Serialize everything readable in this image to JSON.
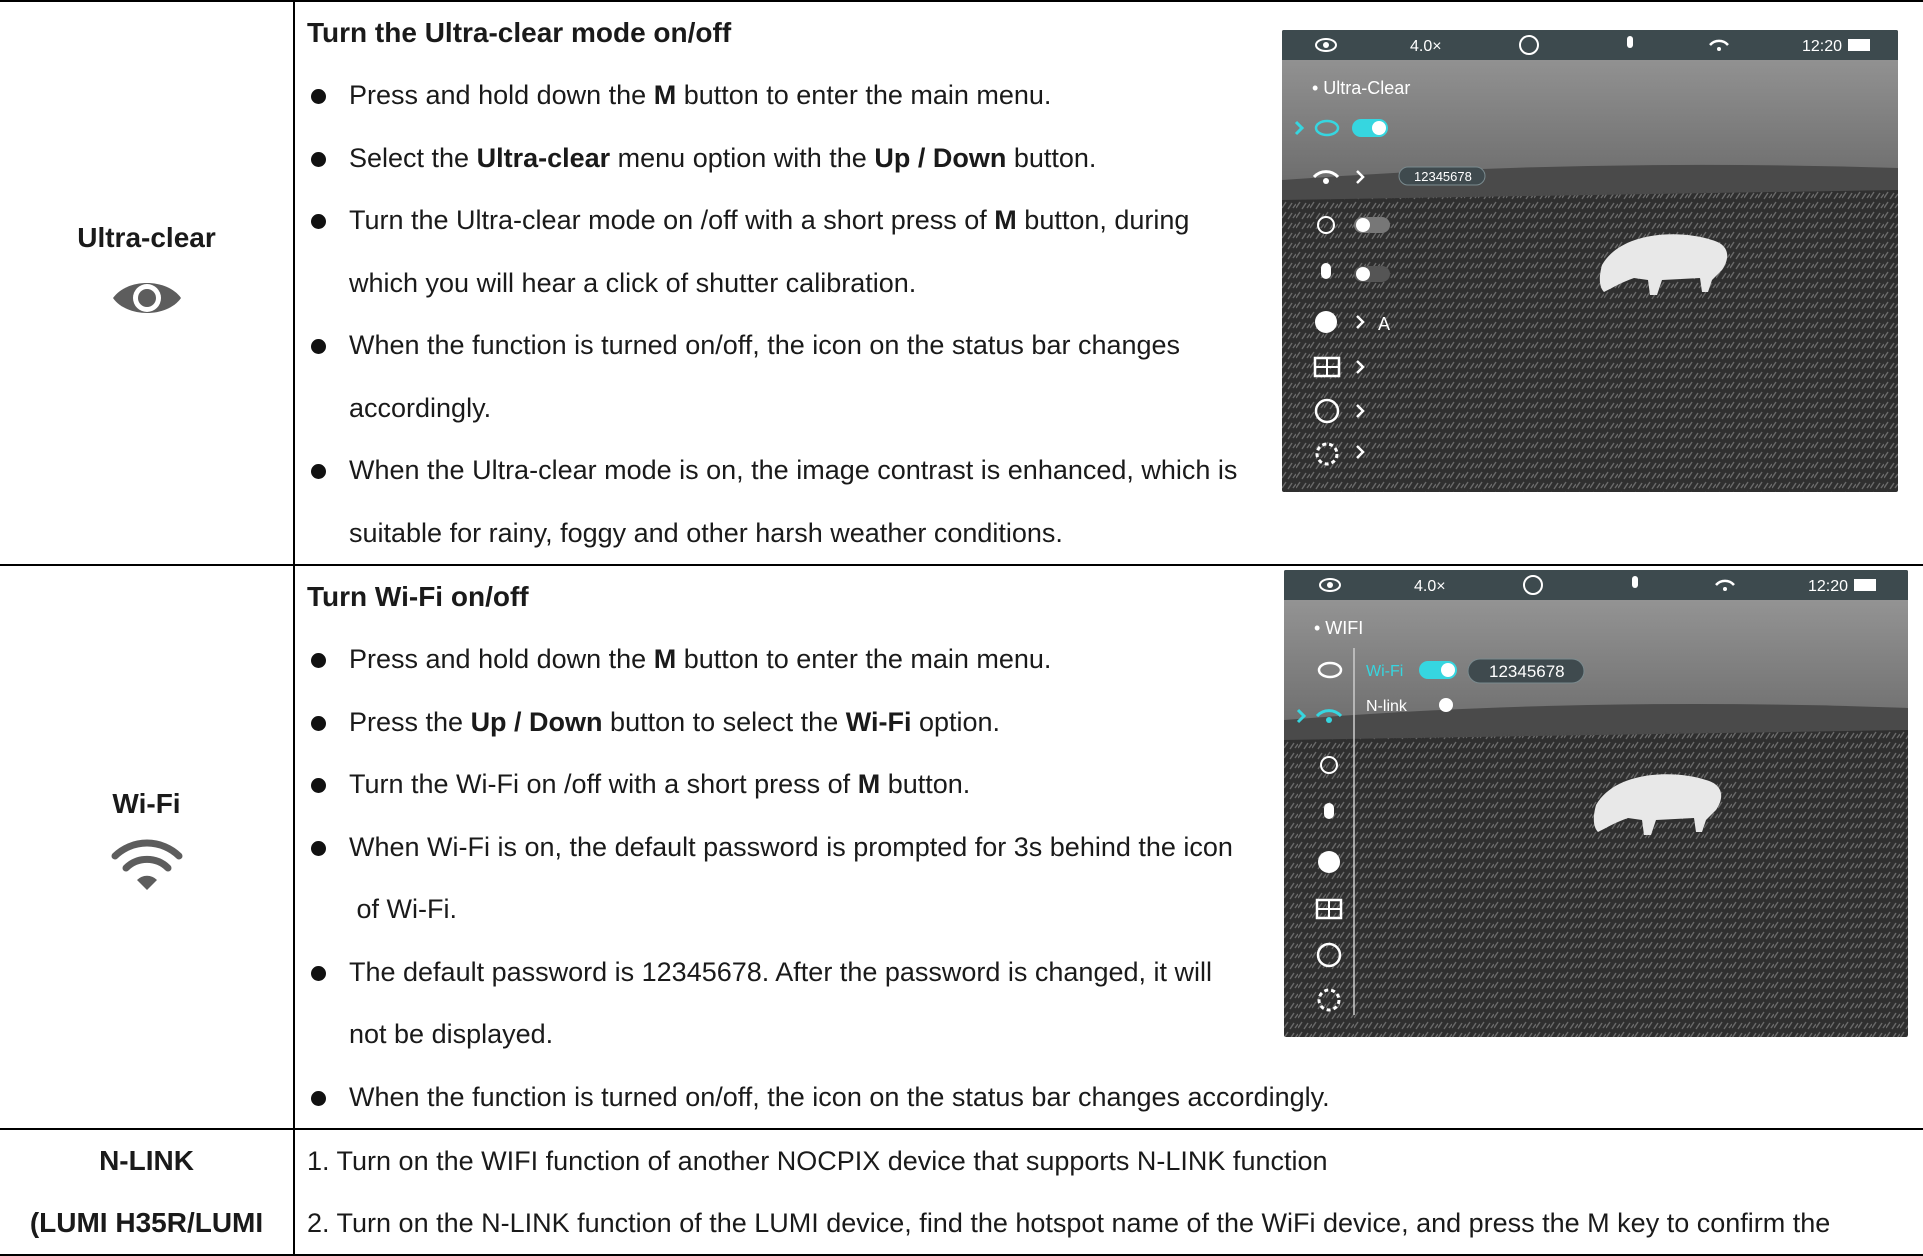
{
  "rows": [
    {
      "label": "Ultra-clear",
      "icon": "eye-icon",
      "heading": "Turn the Ultra-clear mode on/off",
      "bullets": [
        {
          "parts": [
            "Press and hold down the ",
            "M",
            " button to enter the main menu."
          ]
        },
        {
          "parts": [
            "Select the ",
            "Ultra-clear",
            " menu option with the ",
            "Up / Down",
            " button."
          ]
        },
        {
          "line1": [
            "Turn the Ultra-clear mode on /off with a short press of ",
            "M",
            " button, during"
          ],
          "line2": "which you will hear a click of shutter calibration."
        },
        {
          "line1": "When the function is turned on/off, the icon on the status bar changes",
          "line2": "accordingly."
        },
        {
          "line1": "When the Ultra-clear mode is on, the image contrast is enhanced, which is",
          "line2": "suitable for rainy, foggy and other harsh weather conditions."
        }
      ],
      "screen": {
        "zoom": "4.0×",
        "time": "12:20",
        "menu_title": "• Ultra-Clear",
        "wifi_password": "12345678",
        "shutter_mode": "A"
      }
    },
    {
      "label": "Wi-Fi",
      "icon": "wifi-icon",
      "heading": "Turn Wi-Fi on/off",
      "bullets": [
        {
          "parts": [
            "Press and hold down the ",
            "M",
            " button to enter the main menu."
          ]
        },
        {
          "parts": [
            "Press the ",
            "Up / Down",
            " button to select the ",
            "Wi-Fi",
            " option."
          ]
        },
        {
          "parts": [
            "Turn the Wi-Fi on /off with a short press of ",
            "M",
            " button."
          ]
        },
        {
          "line1": "When Wi-Fi is on, the default password is prompted for 3s behind the icon",
          "line2": " of Wi-Fi."
        },
        {
          "line1": "The default password is 12345678. After the password is changed, it will",
          "line2": "not be displayed."
        },
        {
          "text": "When the function is turned on/off, the icon on the status bar changes accordingly."
        }
      ],
      "screen": {
        "zoom": "4.0×",
        "time": "12:20",
        "menu_title": "• WIFI",
        "wifi_label": "Wi-Fi",
        "nlink_label": "N-link",
        "wifi_password": "12345678"
      }
    },
    {
      "label_line1": "N-LINK",
      "label_line2": "(LUMI H35R/LUMI",
      "steps": [
        "1. Turn on the WIFI function of another NOCPIX device that supports N-LINK function",
        "2. Turn on the N-LINK function of the LUMI device, find the hotspot name of the WiFi device, and press the M key to confirm the"
      ]
    }
  ]
}
